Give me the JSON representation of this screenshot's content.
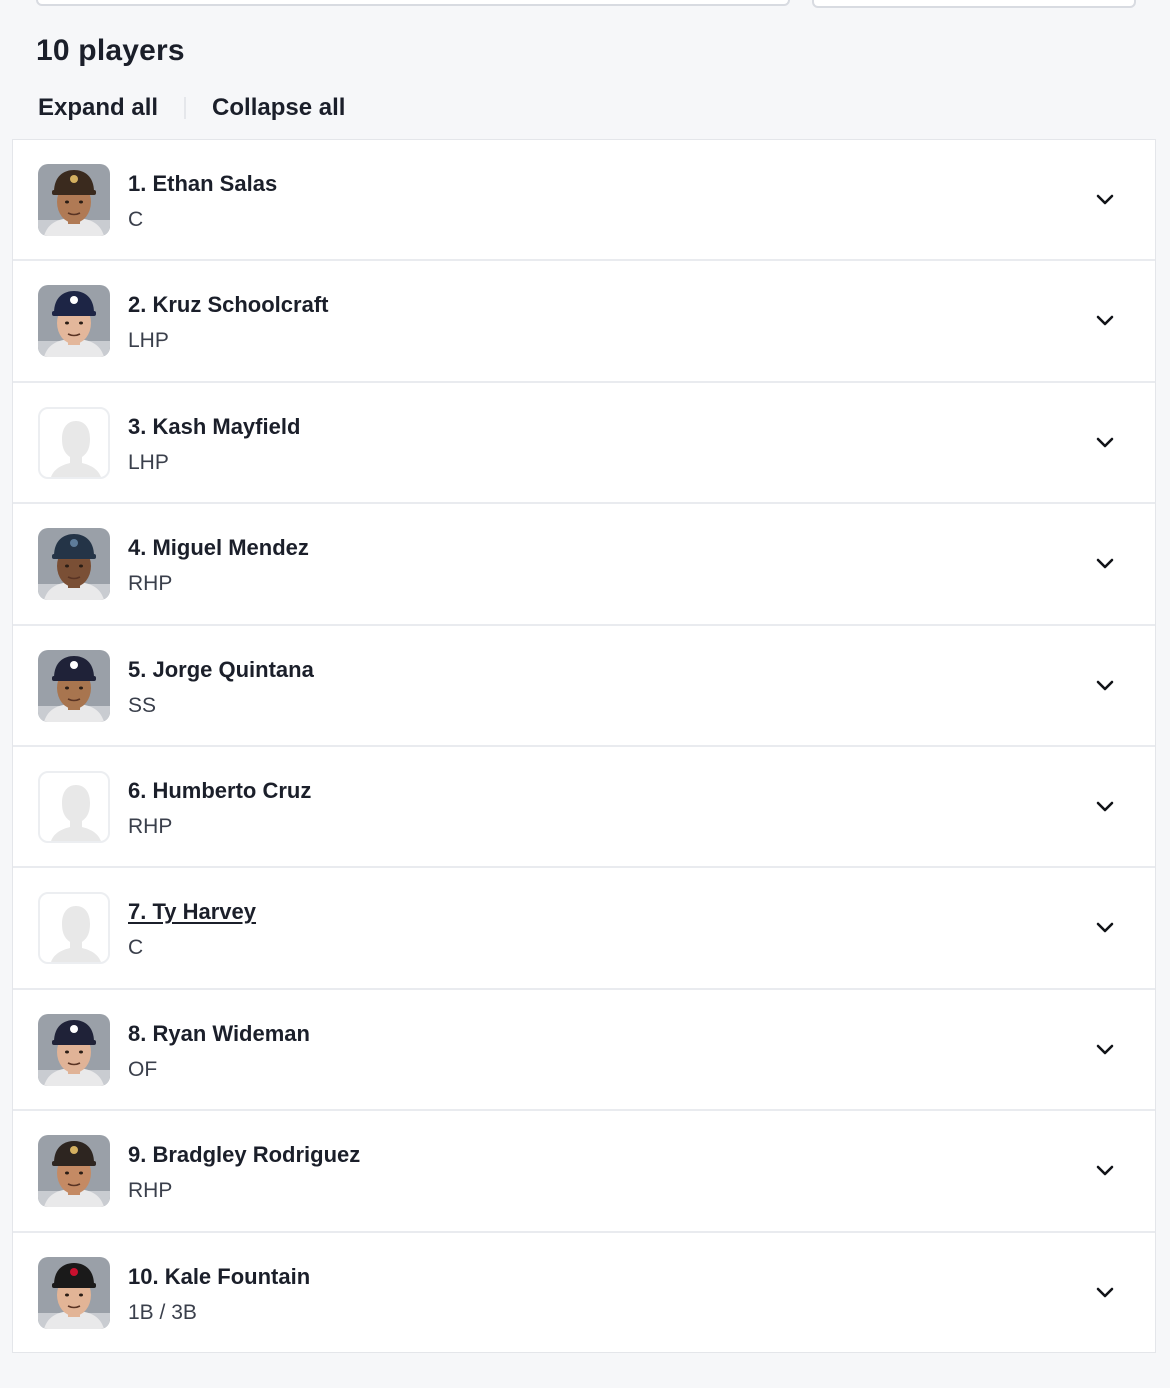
{
  "header": {
    "count_label": "10 players"
  },
  "toolbar": {
    "expand_label": "Expand all",
    "collapse_label": "Collapse all"
  },
  "players": [
    {
      "name": "1. Ethan Salas",
      "position": "C",
      "has_photo": true,
      "cap": "#3a2a1e",
      "skin": "#b07a55",
      "logo": "#d4b060"
    },
    {
      "name": "2. Kruz Schoolcraft",
      "position": "LHP",
      "has_photo": true,
      "cap": "#1d2545",
      "skin": "#e3b79b",
      "logo": "#ffffff"
    },
    {
      "name": "3. Kash Mayfield",
      "position": "LHP",
      "has_photo": false
    },
    {
      "name": "4. Miguel Mendez",
      "position": "RHP",
      "has_photo": true,
      "cap": "#243447",
      "skin": "#7a4f35",
      "logo": "#5e7c9a"
    },
    {
      "name": "5. Jorge Quintana",
      "position": "SS",
      "has_photo": true,
      "cap": "#1f2238",
      "skin": "#a8754f",
      "logo": "#ffffff"
    },
    {
      "name": "6. Humberto Cruz",
      "position": "RHP",
      "has_photo": false
    },
    {
      "name": "7. Ty Harvey",
      "position": "C",
      "has_photo": false,
      "underlined": true
    },
    {
      "name": "8. Ryan Wideman",
      "position": "OF",
      "has_photo": true,
      "cap": "#1f2238",
      "skin": "#e0b397",
      "logo": "#ffffff"
    },
    {
      "name": "9. Bradgley Rodriguez",
      "position": "RHP",
      "has_photo": true,
      "cap": "#2d2520",
      "skin": "#c48a64",
      "logo": "#d4b060"
    },
    {
      "name": "10. Kale Fountain",
      "position": "1B / 3B",
      "has_photo": true,
      "cap": "#1a1a1a",
      "skin": "#e2b496",
      "logo": "#c8102e"
    }
  ],
  "icons": {
    "chevron": "chevron-down-icon",
    "placeholder": "player-silhouette-icon"
  },
  "colors": {
    "page_bg": "#f6f7f9",
    "text": "#1b1f2a",
    "border": "#e9ebef",
    "placeholder_silhouette": "#e8e8e8"
  }
}
